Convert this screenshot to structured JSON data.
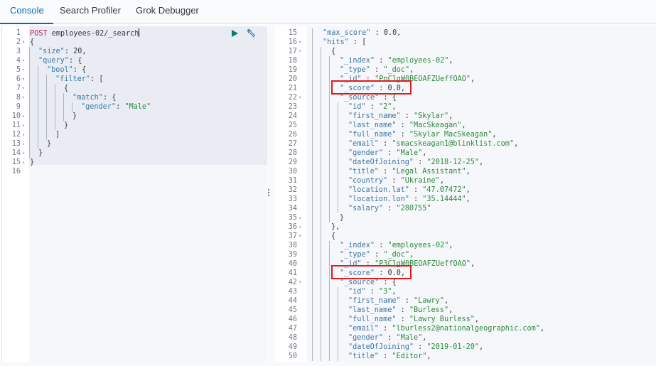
{
  "tabs": [
    {
      "label": "Console",
      "active": true
    },
    {
      "label": "Search Profiler",
      "active": false
    },
    {
      "label": "Grok Debugger",
      "active": false
    }
  ],
  "request_editor": {
    "actions": {
      "run_icon": "play-icon",
      "settings_icon": "wrench-icon"
    },
    "lines": [
      {
        "n": "1",
        "fold": "",
        "indent": 0,
        "parts": [
          [
            "m",
            "POST"
          ],
          [
            "t",
            " employees-02/_search"
          ]
        ],
        "cursor": true
      },
      {
        "n": "2",
        "fold": "▾",
        "indent": 0,
        "parts": [
          [
            "t",
            "{"
          ]
        ]
      },
      {
        "n": "3",
        "fold": "",
        "indent": 1,
        "parts": [
          [
            "k",
            "\"size\""
          ],
          [
            "t",
            ": 20,"
          ]
        ]
      },
      {
        "n": "4",
        "fold": "▾",
        "indent": 1,
        "parts": [
          [
            "k",
            "\"query\""
          ],
          [
            "t",
            ": {"
          ]
        ]
      },
      {
        "n": "5",
        "fold": "▾",
        "indent": 2,
        "parts": [
          [
            "k",
            "\"bool\""
          ],
          [
            "t",
            ": {"
          ]
        ]
      },
      {
        "n": "6",
        "fold": "▾",
        "indent": 3,
        "parts": [
          [
            "k",
            "\"filter\""
          ],
          [
            "t",
            ": ["
          ]
        ]
      },
      {
        "n": "7",
        "fold": "▾",
        "indent": 4,
        "parts": [
          [
            "t",
            "{"
          ]
        ]
      },
      {
        "n": "8",
        "fold": "▾",
        "indent": 5,
        "parts": [
          [
            "k",
            "\"match\""
          ],
          [
            "t",
            ": {"
          ]
        ]
      },
      {
        "n": "9",
        "fold": "",
        "indent": 6,
        "parts": [
          [
            "k",
            "\"gender\""
          ],
          [
            "t",
            ": "
          ],
          [
            "s",
            "\"Male\""
          ]
        ]
      },
      {
        "n": "10",
        "fold": "▴",
        "indent": 5,
        "parts": [
          [
            "t",
            "}"
          ]
        ]
      },
      {
        "n": "11",
        "fold": "▴",
        "indent": 4,
        "parts": [
          [
            "t",
            "}"
          ]
        ]
      },
      {
        "n": "12",
        "fold": "▴",
        "indent": 3,
        "parts": [
          [
            "t",
            "]"
          ]
        ]
      },
      {
        "n": "13",
        "fold": "▴",
        "indent": 2,
        "parts": [
          [
            "t",
            "}"
          ]
        ]
      },
      {
        "n": "14",
        "fold": "▴",
        "indent": 1,
        "parts": [
          [
            "t",
            "}"
          ]
        ]
      },
      {
        "n": "15",
        "fold": "▴",
        "indent": 0,
        "parts": [
          [
            "t",
            "}"
          ]
        ]
      },
      {
        "n": "16",
        "fold": "",
        "indent": 0,
        "parts": []
      }
    ]
  },
  "response_editor": {
    "lines": [
      {
        "n": "15",
        "fold": "",
        "indent": 1,
        "parts": [
          [
            "k",
            "\"max_score\""
          ],
          [
            "t",
            " : 0.0,"
          ]
        ]
      },
      {
        "n": "16",
        "fold": "▾",
        "indent": 1,
        "parts": [
          [
            "k",
            "\"hits\""
          ],
          [
            "t",
            " : ["
          ]
        ]
      },
      {
        "n": "17",
        "fold": "▾",
        "indent": 2,
        "parts": [
          [
            "t",
            "{"
          ]
        ]
      },
      {
        "n": "18",
        "fold": "",
        "indent": 3,
        "parts": [
          [
            "k",
            "\"_index\""
          ],
          [
            "t",
            " : "
          ],
          [
            "s",
            "\"employees-02\""
          ],
          [
            "t",
            ","
          ]
        ]
      },
      {
        "n": "19",
        "fold": "",
        "indent": 3,
        "parts": [
          [
            "k",
            "\"_type\""
          ],
          [
            "t",
            " : "
          ],
          [
            "s",
            "\"_doc\""
          ],
          [
            "t",
            ","
          ]
        ]
      },
      {
        "n": "20",
        "fold": "",
        "indent": 3,
        "parts": [
          [
            "k",
            "\"_id\""
          ],
          [
            "t",
            " : "
          ],
          [
            "s",
            "\"PnC1gW0BEOAFZUeffOAO\""
          ],
          [
            "t",
            ","
          ]
        ]
      },
      {
        "n": "21",
        "fold": "",
        "indent": 3,
        "parts": [
          [
            "k",
            "\"_score\""
          ],
          [
            "t",
            " : 0.0,"
          ]
        ],
        "highlight": true
      },
      {
        "n": "22",
        "fold": "▾",
        "indent": 3,
        "parts": [
          [
            "k",
            "\"_source\""
          ],
          [
            "t",
            " : {"
          ]
        ]
      },
      {
        "n": "23",
        "fold": "",
        "indent": 4,
        "parts": [
          [
            "k",
            "\"id\""
          ],
          [
            "t",
            " : "
          ],
          [
            "s",
            "\"2\""
          ],
          [
            "t",
            ","
          ]
        ]
      },
      {
        "n": "24",
        "fold": "",
        "indent": 4,
        "parts": [
          [
            "k",
            "\"first_name\""
          ],
          [
            "t",
            " : "
          ],
          [
            "s",
            "\"Skylar\""
          ],
          [
            "t",
            ","
          ]
        ]
      },
      {
        "n": "25",
        "fold": "",
        "indent": 4,
        "parts": [
          [
            "k",
            "\"last_name\""
          ],
          [
            "t",
            " : "
          ],
          [
            "s",
            "\"MacSkeagan\""
          ],
          [
            "t",
            ","
          ]
        ]
      },
      {
        "n": "26",
        "fold": "",
        "indent": 4,
        "parts": [
          [
            "k",
            "\"full_name\""
          ],
          [
            "t",
            " : "
          ],
          [
            "s",
            "\"Skylar MacSkeagan\""
          ],
          [
            "t",
            ","
          ]
        ]
      },
      {
        "n": "27",
        "fold": "",
        "indent": 4,
        "parts": [
          [
            "k",
            "\"email\""
          ],
          [
            "t",
            " : "
          ],
          [
            "s",
            "\"smacskeagan1@blinklist.com\""
          ],
          [
            "t",
            ","
          ]
        ]
      },
      {
        "n": "28",
        "fold": "",
        "indent": 4,
        "parts": [
          [
            "k",
            "\"gender\""
          ],
          [
            "t",
            " : "
          ],
          [
            "s",
            "\"Male\""
          ],
          [
            "t",
            ","
          ]
        ]
      },
      {
        "n": "29",
        "fold": "",
        "indent": 4,
        "parts": [
          [
            "k",
            "\"dateOfJoining\""
          ],
          [
            "t",
            " : "
          ],
          [
            "s",
            "\"2018-12-25\""
          ],
          [
            "t",
            ","
          ]
        ]
      },
      {
        "n": "30",
        "fold": "",
        "indent": 4,
        "parts": [
          [
            "k",
            "\"title\""
          ],
          [
            "t",
            " : "
          ],
          [
            "s",
            "\"Legal Assistant\""
          ],
          [
            "t",
            ","
          ]
        ]
      },
      {
        "n": "31",
        "fold": "",
        "indent": 4,
        "parts": [
          [
            "k",
            "\"country\""
          ],
          [
            "t",
            " : "
          ],
          [
            "s",
            "\"Ukraine\""
          ],
          [
            "t",
            ","
          ]
        ]
      },
      {
        "n": "32",
        "fold": "",
        "indent": 4,
        "parts": [
          [
            "k",
            "\"location.lat\""
          ],
          [
            "t",
            " : "
          ],
          [
            "s",
            "\"47.07472\""
          ],
          [
            "t",
            ","
          ]
        ]
      },
      {
        "n": "33",
        "fold": "",
        "indent": 4,
        "parts": [
          [
            "k",
            "\"location.lon\""
          ],
          [
            "t",
            " : "
          ],
          [
            "s",
            "\"35.14444\""
          ],
          [
            "t",
            ","
          ]
        ]
      },
      {
        "n": "34",
        "fold": "",
        "indent": 4,
        "parts": [
          [
            "k",
            "\"salary\""
          ],
          [
            "t",
            " : "
          ],
          [
            "s",
            "\"280755\""
          ]
        ]
      },
      {
        "n": "35",
        "fold": "▴",
        "indent": 3,
        "parts": [
          [
            "t",
            "}"
          ]
        ]
      },
      {
        "n": "36",
        "fold": "▴",
        "indent": 2,
        "parts": [
          [
            "t",
            "},"
          ]
        ]
      },
      {
        "n": "37",
        "fold": "▾",
        "indent": 2,
        "parts": [
          [
            "t",
            "{"
          ]
        ]
      },
      {
        "n": "38",
        "fold": "",
        "indent": 3,
        "parts": [
          [
            "k",
            "\"_index\""
          ],
          [
            "t",
            " : "
          ],
          [
            "s",
            "\"employees-02\""
          ],
          [
            "t",
            ","
          ]
        ]
      },
      {
        "n": "39",
        "fold": "",
        "indent": 3,
        "parts": [
          [
            "k",
            "\"_type\""
          ],
          [
            "t",
            " : "
          ],
          [
            "s",
            "\"_doc\""
          ],
          [
            "t",
            ","
          ]
        ]
      },
      {
        "n": "40",
        "fold": "",
        "indent": 3,
        "parts": [
          [
            "k",
            "\"_id\""
          ],
          [
            "t",
            " : "
          ],
          [
            "s",
            "\"P3C1gW0BEOAFZUeffOAO\""
          ],
          [
            "t",
            ","
          ]
        ]
      },
      {
        "n": "41",
        "fold": "",
        "indent": 3,
        "parts": [
          [
            "k",
            "\"_score\""
          ],
          [
            "t",
            " : 0.0,"
          ]
        ],
        "highlight": true
      },
      {
        "n": "42",
        "fold": "▾",
        "indent": 3,
        "parts": [
          [
            "k",
            "\"_source\""
          ],
          [
            "t",
            " : {"
          ]
        ]
      },
      {
        "n": "43",
        "fold": "",
        "indent": 4,
        "parts": [
          [
            "k",
            "\"id\""
          ],
          [
            "t",
            " : "
          ],
          [
            "s",
            "\"3\""
          ],
          [
            "t",
            ","
          ]
        ]
      },
      {
        "n": "44",
        "fold": "",
        "indent": 4,
        "parts": [
          [
            "k",
            "\"first_name\""
          ],
          [
            "t",
            " : "
          ],
          [
            "s",
            "\"Lawry\""
          ],
          [
            "t",
            ","
          ]
        ]
      },
      {
        "n": "45",
        "fold": "",
        "indent": 4,
        "parts": [
          [
            "k",
            "\"last_name\""
          ],
          [
            "t",
            " : "
          ],
          [
            "s",
            "\"Burless\""
          ],
          [
            "t",
            ","
          ]
        ]
      },
      {
        "n": "46",
        "fold": "",
        "indent": 4,
        "parts": [
          [
            "k",
            "\"full_name\""
          ],
          [
            "t",
            " : "
          ],
          [
            "s",
            "\"Lawry Burless\""
          ],
          [
            "t",
            ","
          ]
        ]
      },
      {
        "n": "47",
        "fold": "",
        "indent": 4,
        "parts": [
          [
            "k",
            "\"email\""
          ],
          [
            "t",
            " : "
          ],
          [
            "s",
            "\"lburless2@nationalgeographic.com\""
          ],
          [
            "t",
            ","
          ]
        ]
      },
      {
        "n": "48",
        "fold": "",
        "indent": 4,
        "parts": [
          [
            "k",
            "\"gender\""
          ],
          [
            "t",
            " : "
          ],
          [
            "s",
            "\"Male\""
          ],
          [
            "t",
            ","
          ]
        ]
      },
      {
        "n": "49",
        "fold": "",
        "indent": 4,
        "parts": [
          [
            "k",
            "\"dateOfJoining\""
          ],
          [
            "t",
            " : "
          ],
          [
            "s",
            "\"2019-01-20\""
          ],
          [
            "t",
            ","
          ]
        ]
      },
      {
        "n": "50",
        "fold": "",
        "indent": 4,
        "parts": [
          [
            "k",
            "\"title\""
          ],
          [
            "t",
            " : "
          ],
          [
            "s",
            "\"Editor\""
          ],
          [
            "t",
            ","
          ]
        ]
      }
    ]
  },
  "colors": {
    "accent": "#006bb4",
    "run": "#017d73",
    "highlight_box": "#e01b1b",
    "json_key": "#3a77a6",
    "json_string": "#2d8b3a",
    "http_method": "#c2185b"
  }
}
